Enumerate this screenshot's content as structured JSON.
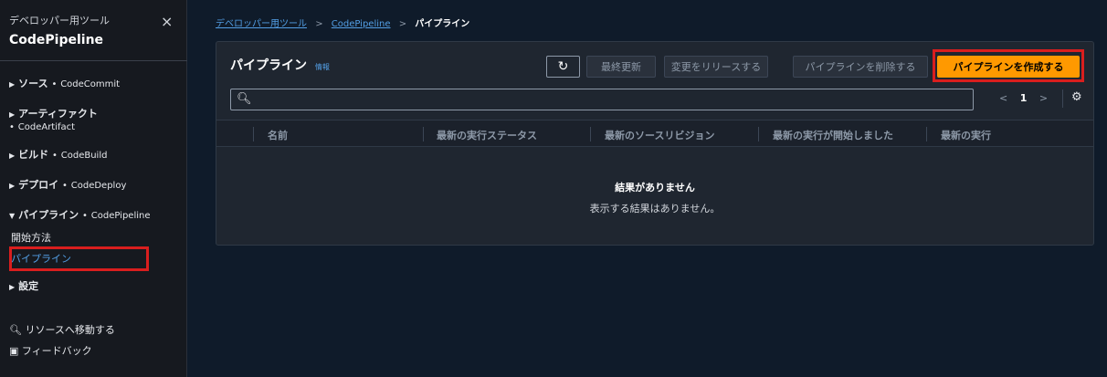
{
  "sidebar": {
    "subtitle": "デベロッパー用ツール",
    "title": "CodePipeline",
    "close_icon": "×",
    "sections": [
      {
        "label": "ソース",
        "service": "CodeCommit",
        "state": "collapsed"
      },
      {
        "label": "アーティファクト",
        "service": "CodeArtifact",
        "state": "collapsed"
      },
      {
        "label": "ビルド",
        "service": "CodeBuild",
        "state": "collapsed"
      },
      {
        "label": "デプロイ",
        "service": "CodeDeploy",
        "state": "collapsed"
      },
      {
        "label": "パイプライン",
        "service": "CodePipeline",
        "state": "expanded"
      }
    ],
    "pipeline_items": [
      "開始方法",
      "パイプライン"
    ],
    "settings_label": "設定",
    "bottom": {
      "goto_resource": "リソースへ移動する",
      "feedback": "フィードバック"
    },
    "bullet": "•"
  },
  "breadcrumb": {
    "items": [
      "デベロッパー用ツール",
      "CodePipeline"
    ],
    "current": "パイプライン",
    "separator": ">"
  },
  "panel": {
    "title": "パイプライン",
    "info": "情報",
    "buttons": {
      "refresh": "↻",
      "last_updated": "最終更新",
      "release_change": "変更をリリースする",
      "delete_pipeline": "パイプラインを削除する",
      "create_pipeline": "パイプラインを作成する"
    },
    "search": {
      "placeholder": "",
      "icon": "search-icon"
    },
    "pager": {
      "prev": "<",
      "page": "1",
      "next": ">"
    },
    "settings_icon": "gear-icon",
    "columns": [
      "名前",
      "最新の実行ステータス",
      "最新のソースリビジョン",
      "最新の実行が開始しました",
      "最新の実行"
    ],
    "empty": {
      "title": "結果がありません",
      "description": "表示する結果はありません。"
    }
  },
  "colors": {
    "accent": "#ff9900",
    "link": "#539fe5",
    "highlight": "#d91e1e"
  }
}
